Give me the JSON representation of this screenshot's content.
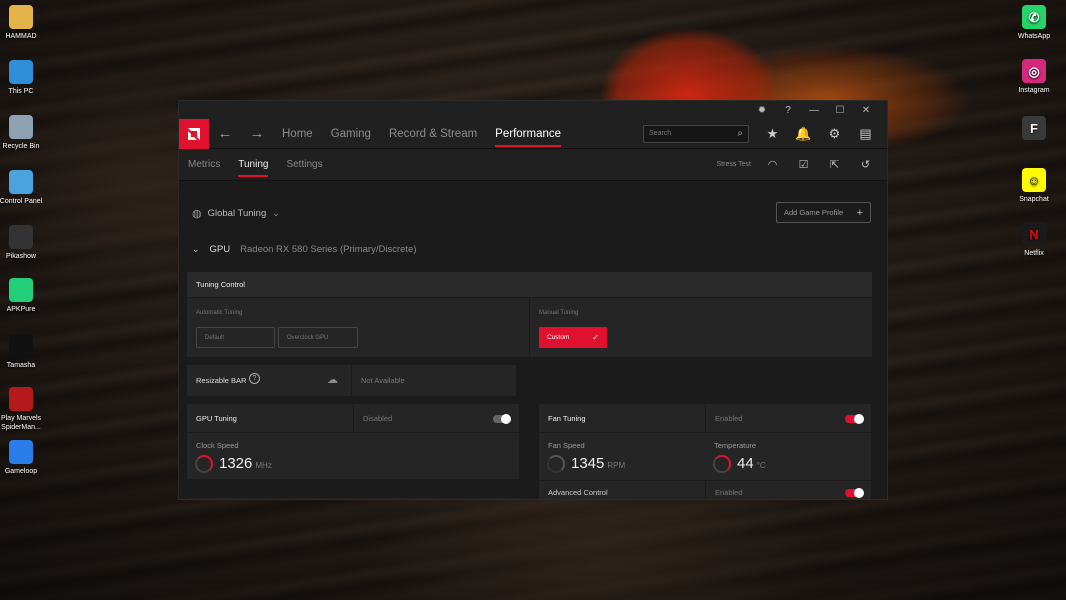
{
  "desktop": {
    "left_icons": [
      {
        "label": "HAMMAD",
        "icon": "folder-user-icon",
        "color": "#e2b44a"
      },
      {
        "label": "This PC",
        "icon": "monitor-icon",
        "color": "#2e8fd8"
      },
      {
        "label": "Recycle Bin",
        "icon": "recycle-bin-icon",
        "color": "#8fa2b3"
      },
      {
        "label": "Control Panel",
        "icon": "control-panel-icon",
        "color": "#4aa3df"
      },
      {
        "label": "Pikashow",
        "icon": "pikashow-icon",
        "color": "#333333"
      },
      {
        "label": "APKPure",
        "icon": "apkpure-icon",
        "color": "#24cd77"
      },
      {
        "label": "Tamasha",
        "icon": "tamasha-icon",
        "color": "#111111"
      },
      {
        "label": "Play Marvels SpiderMan...",
        "icon": "spiderman-icon",
        "color": "#b51a1a"
      },
      {
        "label": "Gameloop",
        "icon": "gameloop-icon",
        "color": "#2a7ce8"
      }
    ],
    "right_icons": [
      {
        "label": "WhatsApp",
        "icon": "whatsapp-icon",
        "color": "#25d366",
        "glyph": "✆"
      },
      {
        "label": "Instagram",
        "icon": "instagram-icon",
        "color": "#d6297c",
        "glyph": "◎"
      },
      {
        "label": "",
        "icon": "file-f-icon",
        "color": "#3a3a3a",
        "glyph": "F"
      },
      {
        "label": "Snapchat",
        "icon": "snapchat-icon",
        "color": "#fffc00",
        "glyph": "☺"
      },
      {
        "label": "Netflix",
        "icon": "netflix-icon",
        "color": "#1a1a1a",
        "glyph": "N"
      }
    ]
  },
  "window": {
    "nav": {
      "items": [
        "Home",
        "Gaming",
        "Record & Stream",
        "Performance"
      ],
      "active": "Performance",
      "search_placeholder": "Search"
    },
    "subnav": {
      "items": [
        "Metrics",
        "Tuning",
        "Settings"
      ],
      "active": "Tuning",
      "stress_test": "Stress Test"
    },
    "global_tuning": "Global Tuning",
    "add_game_profile": "Add Game Profile",
    "gpu_label": "GPU",
    "gpu_name": "Radeon RX 580 Series (Primary/Discrete)",
    "tuning_control": {
      "title": "Tuning Control",
      "automatic_label": "Automatic Tuning",
      "default_btn": "Default",
      "overclock_btn": "Overclock GPU",
      "manual_label": "Manual Tuning",
      "custom_btn": "Custom"
    },
    "resizable_bar": {
      "label": "Resizable BAR",
      "status": "Not Available"
    },
    "gpu_tuning": {
      "title": "GPU Tuning",
      "state": "Disabled",
      "enabled": false,
      "clock_label": "Clock Speed",
      "clock_value": "1326",
      "clock_unit": "MHz"
    },
    "fan_tuning": {
      "title": "Fan Tuning",
      "state": "Enabled",
      "enabled": true,
      "fan_label": "Fan Speed",
      "fan_value": "1345",
      "fan_unit": "RPM",
      "temp_label": "Temperature",
      "temp_value": "44",
      "temp_unit": "°C",
      "advanced_label": "Advanced Control",
      "advanced_state": "Enabled"
    },
    "accent_color": "#e0102f"
  }
}
